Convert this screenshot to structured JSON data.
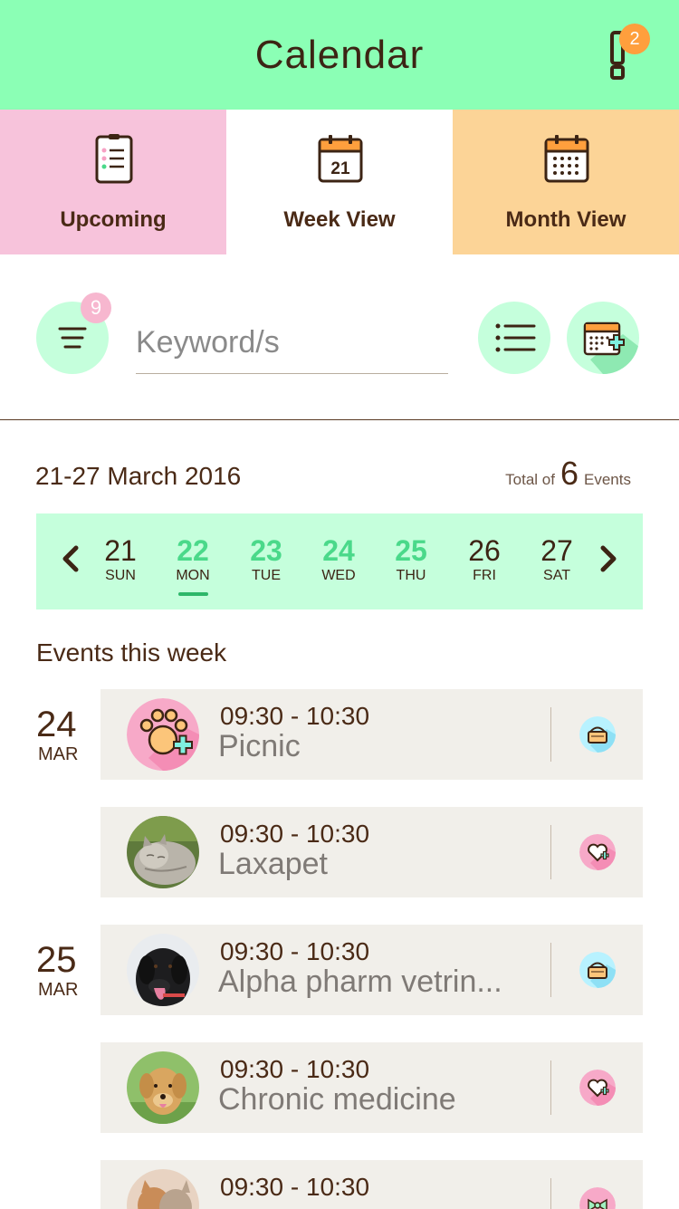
{
  "header": {
    "title": "Calendar",
    "alert_count": "2"
  },
  "tabs": [
    {
      "label": "Upcoming",
      "icon": "list-doc-icon",
      "color": "#f7c3db"
    },
    {
      "label": "Week View",
      "icon": "calendar-day-icon",
      "day": "21",
      "color": "#ffffff"
    },
    {
      "label": "Month View",
      "icon": "calendar-grid-icon",
      "color": "#fcd497"
    }
  ],
  "toolbar": {
    "filter_count": "9",
    "search_placeholder": "Keyword/s"
  },
  "summary": {
    "range": "21-27 March 2016",
    "total_prefix": "Total of",
    "total_count": "6",
    "total_suffix": "Events"
  },
  "week": {
    "days": [
      {
        "num": "21",
        "name": "SUN",
        "has_event": false
      },
      {
        "num": "22",
        "name": "MON",
        "has_event": true,
        "selected": true
      },
      {
        "num": "23",
        "name": "TUE",
        "has_event": true
      },
      {
        "num": "24",
        "name": "WED",
        "has_event": true
      },
      {
        "num": "25",
        "name": "THU",
        "has_event": true
      },
      {
        "num": "26",
        "name": "FRI",
        "has_event": false
      },
      {
        "num": "27",
        "name": "SAT",
        "has_event": false
      }
    ]
  },
  "events_section": {
    "title": "Events this week"
  },
  "dates": [
    {
      "day": "24",
      "month": "MAR"
    },
    {
      "day": "25",
      "month": "MAR"
    }
  ],
  "events": [
    {
      "time": "09:30 - 10:30",
      "title": "Picnic",
      "avatar": "paw-plus-icon",
      "type_icon": "basket-icon"
    },
    {
      "time": "09:30 - 10:30",
      "title": "Laxapet",
      "avatar": "cat-photo",
      "type_icon": "heart-plus-icon"
    },
    {
      "time": "09:30 - 10:30",
      "title": "Alpha pharm vetrin...",
      "avatar": "black-dog-photo",
      "type_icon": "basket-icon"
    },
    {
      "time": "09:30 - 10:30",
      "title": "Chronic medicine",
      "avatar": "golden-dog-photo",
      "type_icon": "heart-plus-icon"
    },
    {
      "time": "09:30 - 10:30",
      "title": "",
      "avatar": "kitten-photo",
      "type_icon": "bow-icon"
    }
  ],
  "colors": {
    "header": "#8bffb5",
    "accent_green": "#4ad98a",
    "badge_orange": "#ff9f3d",
    "badge_pink": "#f7b7cf",
    "card_bg": "#f1efea"
  }
}
